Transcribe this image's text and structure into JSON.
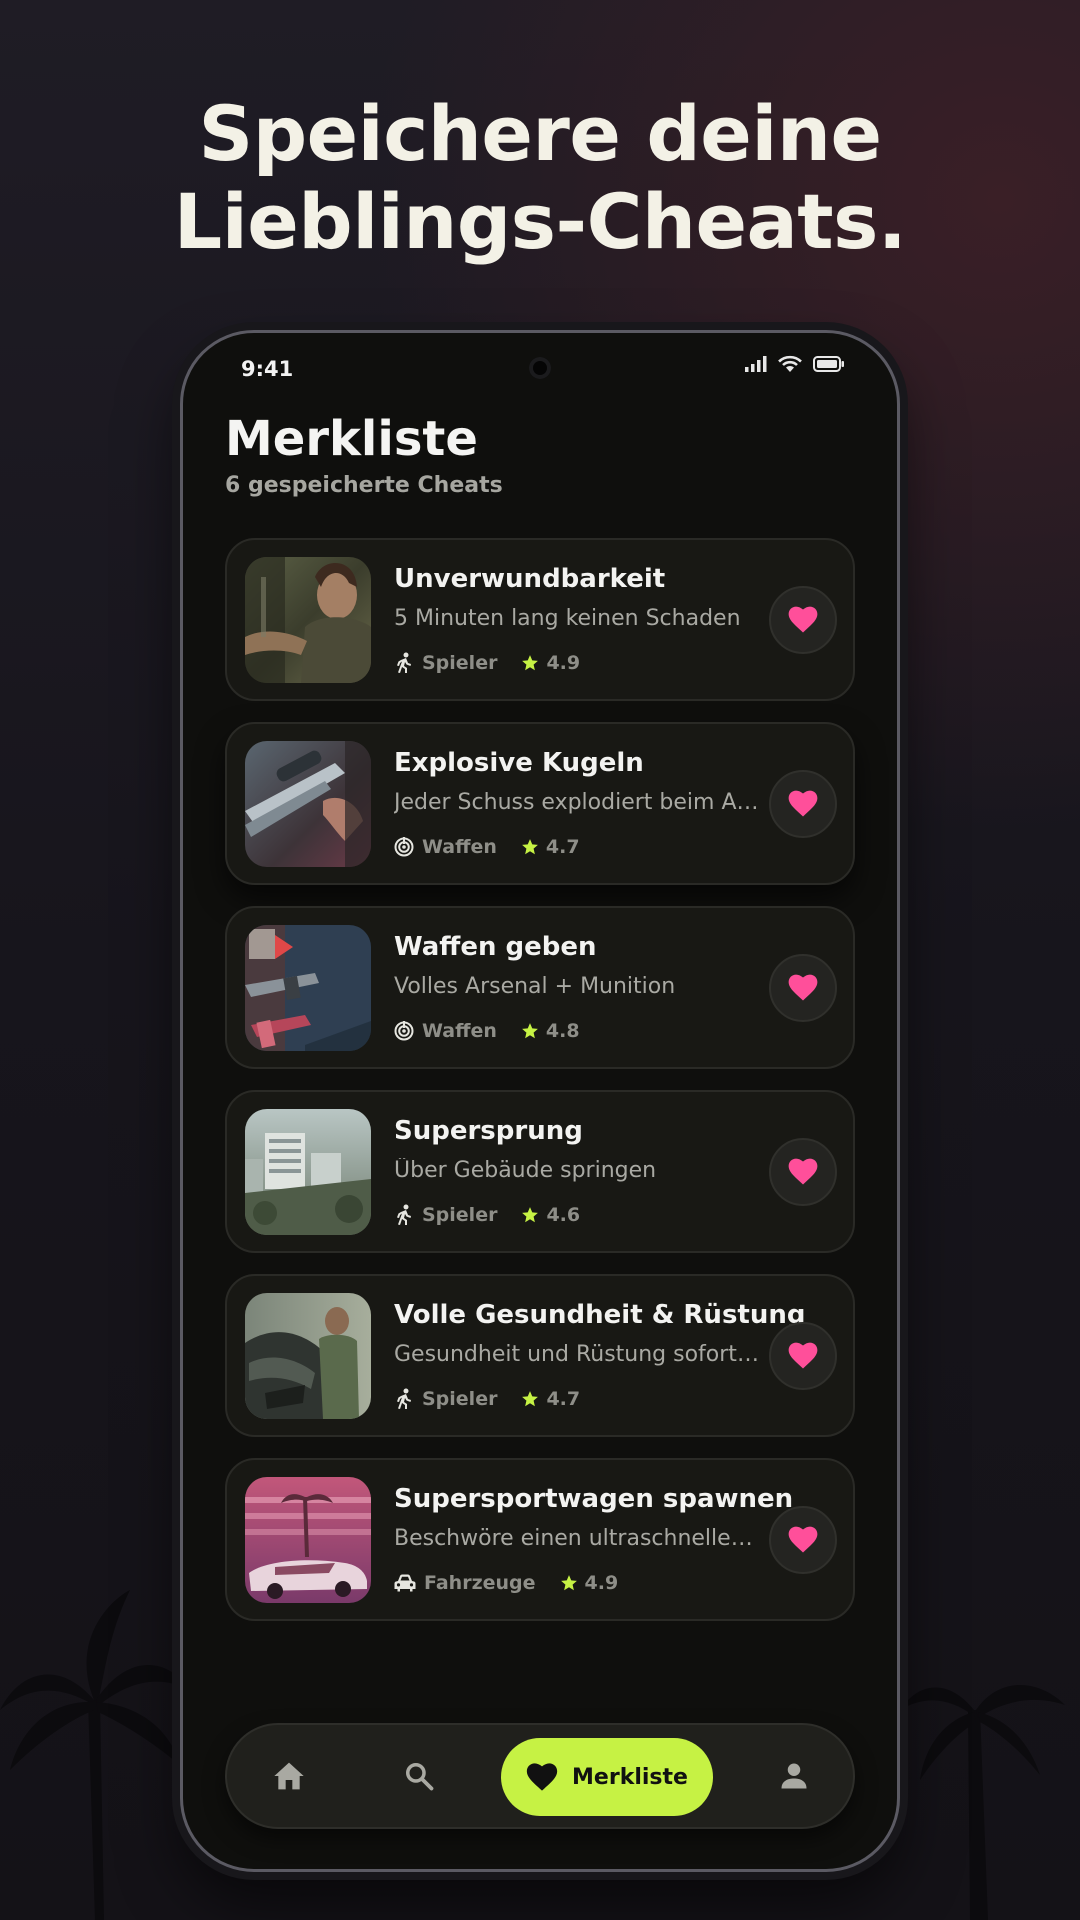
{
  "headline": {
    "line1": "Speichere deine",
    "line2": "Lieblings-Cheats."
  },
  "status_bar": {
    "time": "9:41",
    "icons": [
      "signal-icon",
      "wifi-icon",
      "battery-icon"
    ]
  },
  "screen": {
    "title": "Merkliste",
    "subtitle": "6 gespeicherte Cheats"
  },
  "cards": [
    {
      "title": "Unverwundbarkeit",
      "description": "5 Minuten lang keinen Schaden",
      "category": "Spieler",
      "category_icon": "runner-icon",
      "rating": "4.9",
      "favorited": true
    },
    {
      "title": "Explosive Kugeln",
      "description": "Jeder Schuss explodiert beim Aufprall",
      "category": "Waffen",
      "category_icon": "target-icon",
      "rating": "4.7",
      "favorited": true
    },
    {
      "title": "Waffen geben",
      "description": "Volles Arsenal + Munition",
      "category": "Waffen",
      "category_icon": "target-icon",
      "rating": "4.8",
      "favorited": true
    },
    {
      "title": "Supersprung",
      "description": "Über Gebäude springen",
      "category": "Spieler",
      "category_icon": "runner-icon",
      "rating": "4.6",
      "favorited": true
    },
    {
      "title": "Volle Gesundheit & Rüstung",
      "description": "Gesundheit und Rüstung sofort auffüllen",
      "category": "Spieler",
      "category_icon": "runner-icon",
      "rating": "4.7",
      "favorited": true
    },
    {
      "title": "Supersportwagen spawnen",
      "description": "Beschwöre einen ultraschnellen Exoten",
      "category": "Fahrzeuge",
      "category_icon": "car-icon",
      "rating": "4.9",
      "favorited": true
    }
  ],
  "nav": {
    "items": [
      "home-icon",
      "search-icon",
      "heart-icon",
      "profile-icon"
    ],
    "active_label": "Merkliste"
  },
  "colors": {
    "accent": "#c6f244",
    "heart": "#ff4f9a",
    "star": "#c6f244",
    "card_bg": "#181814",
    "screen_bg": "#0f0f0d"
  }
}
